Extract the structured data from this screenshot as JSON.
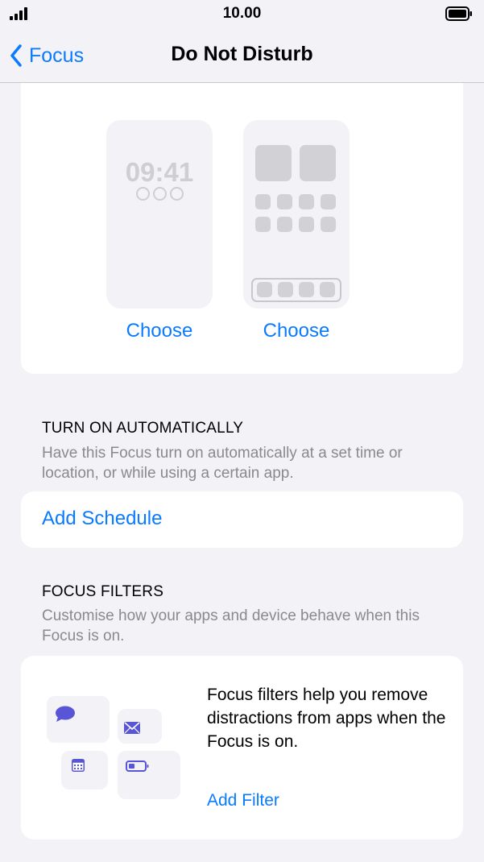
{
  "status_bar": {
    "time": "10.00"
  },
  "nav": {
    "back_label": "Focus",
    "title": "Do Not Disturb"
  },
  "screens": {
    "lock_time": "09:41",
    "lock_choose_label": "Choose",
    "home_choose_label": "Choose"
  },
  "turn_on": {
    "header": "TURN ON AUTOMATICALLY",
    "description": "Have this Focus turn on automatically at a set time or location, or while using a certain app.",
    "add_schedule_label": "Add Schedule"
  },
  "filters": {
    "header": "FOCUS FILTERS",
    "description": "Customise how your apps and device behave when this Focus is on.",
    "body_text": "Focus filters help you remove distractions from apps when the Focus is on.",
    "add_filter_label": "Add Filter",
    "icons": [
      "messages-icon",
      "mail-icon",
      "calendar-icon",
      "battery-icon"
    ]
  },
  "colors": {
    "accent": "#0a7bff",
    "filter_icon": "#5856d6"
  }
}
